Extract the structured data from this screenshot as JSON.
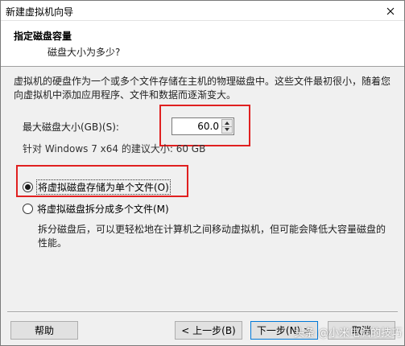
{
  "window": {
    "title": "新建虚拟机向导",
    "close_icon": "close-icon"
  },
  "header": {
    "title": "指定磁盘容量",
    "subtitle": "磁盘大小为多少?"
  },
  "main": {
    "description": "虚拟机的硬盘作为一个或多个文件存储在主机的物理磁盘中。这些文件最初很小，随着您向虚拟机中添加应用程序、文件和数据而逐渐变大。",
    "max_size_label": "最大磁盘大小(GB)(S):",
    "max_size_value": "60.0",
    "recommended_text": "针对 Windows 7 x64 的建议大小: 60 GB",
    "options": [
      {
        "label": "将虚拟磁盘存储为单个文件(O)",
        "selected": true
      },
      {
        "label": "将虚拟磁盘拆分成多个文件(M)",
        "selected": false
      }
    ],
    "split_description": "拆分磁盘后，可以更轻松地在计算机之间移动虚拟机，但可能会降低大容量磁盘的性能。"
  },
  "footer": {
    "help": "帮助",
    "back": "< 上一步(B)",
    "next": "下一步(N) >",
    "cancel": "取消"
  },
  "watermark": "头条 @小米电脑的技巧",
  "colors": {
    "highlight": "#e02020",
    "accent": "#0078d7",
    "background": "#f0f0f0"
  }
}
